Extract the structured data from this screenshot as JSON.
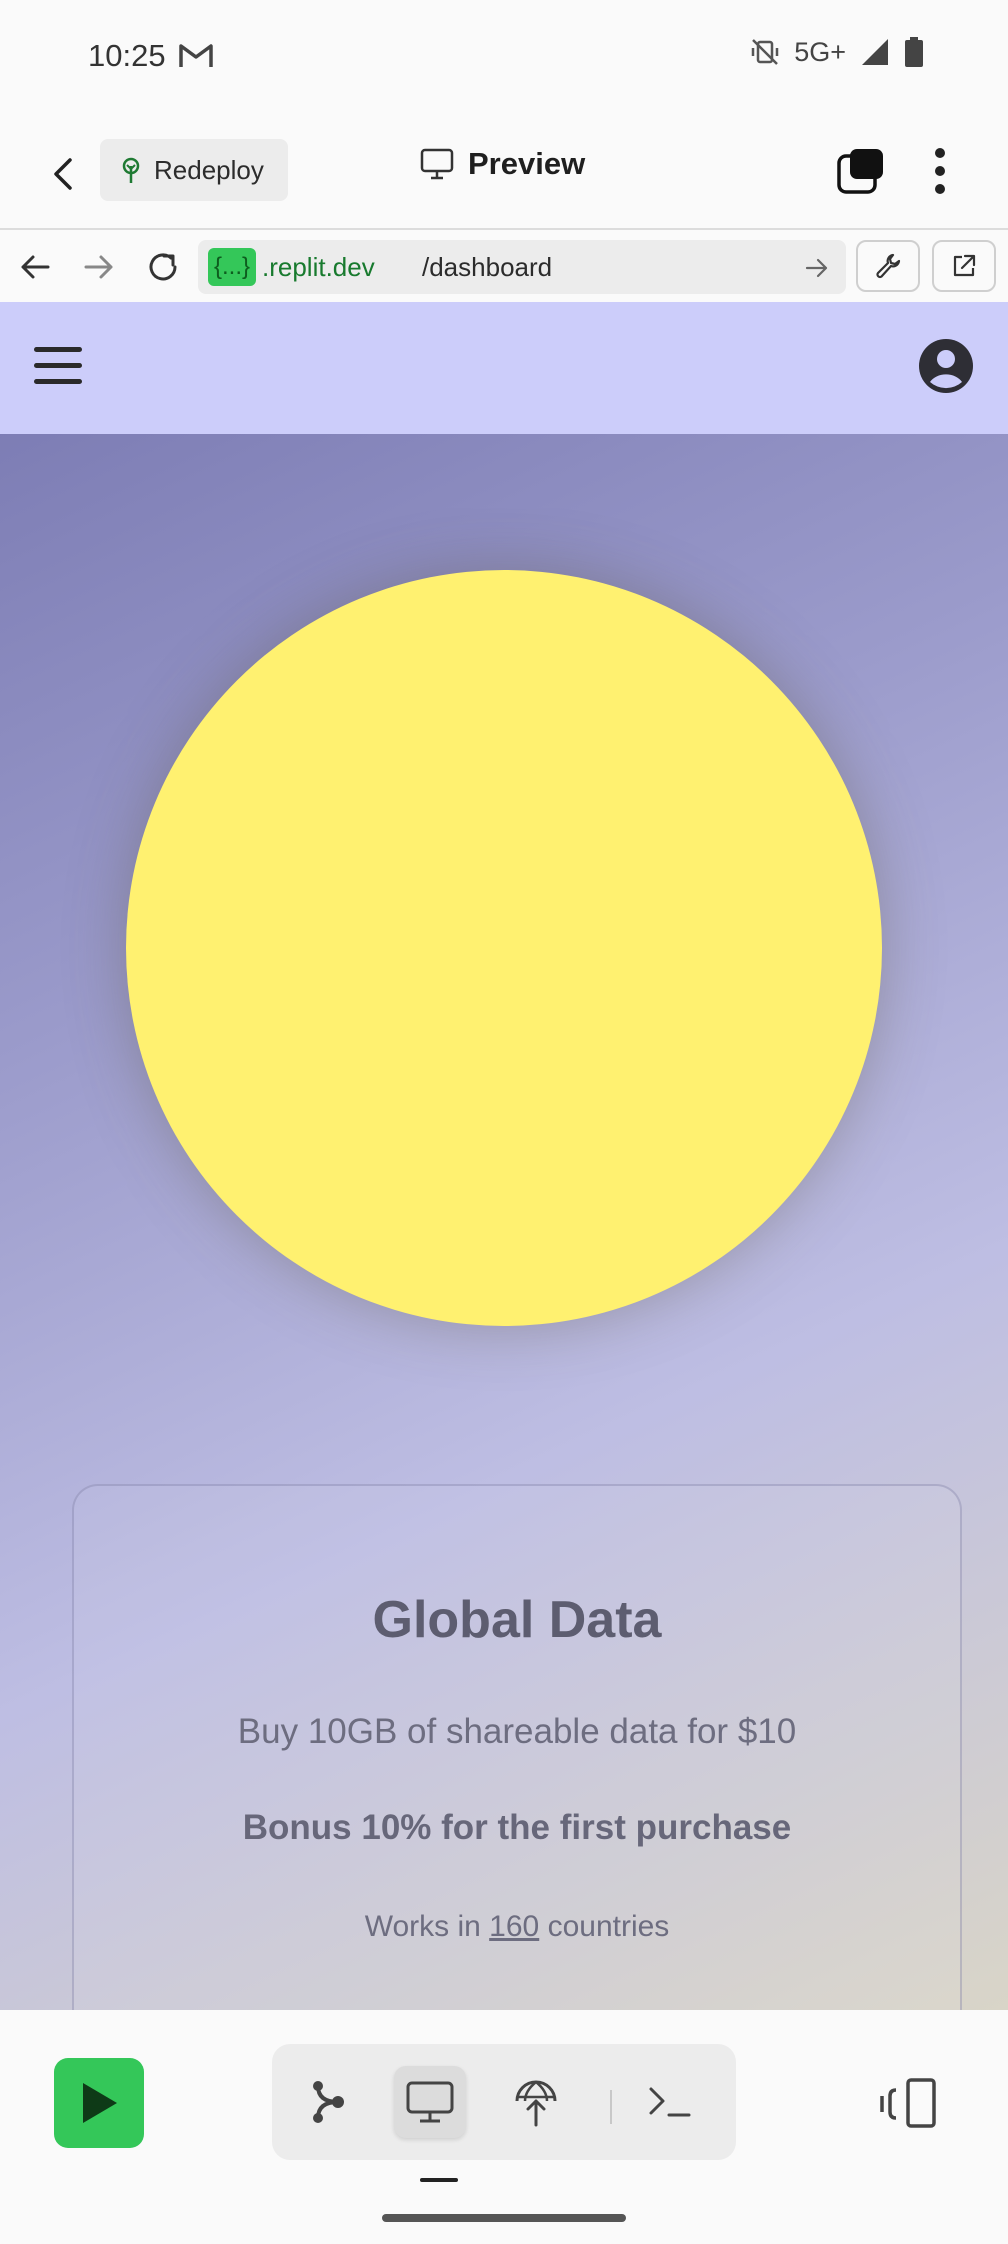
{
  "status_bar": {
    "time": "10:25",
    "network": "5G+"
  },
  "app_header": {
    "redeploy_label": "Redeploy",
    "title": "Preview"
  },
  "url_bar": {
    "domain_chip": "{...}",
    "domain": ".replit.dev",
    "path": "/dashboard"
  },
  "card": {
    "title": "Global Data",
    "subtitle": "Buy 10GB of shareable data for $10",
    "bonus": "Bonus 10% for the first purchase",
    "works_prefix": "Works in",
    "works_count": "160",
    "works_suffix": "countries"
  },
  "colors": {
    "accent_green": "#34c759",
    "site_header": "#cccdfa",
    "sun": "#fff170"
  },
  "icons": [
    "back-arrow-icon",
    "redeploy-icon",
    "monitor-icon",
    "tabs-icon",
    "more-vert-icon",
    "refresh-icon",
    "forward-icon",
    "wrench-icon",
    "external-link-icon",
    "menu-icon",
    "account-icon",
    "play-icon",
    "git-icon",
    "globe-upload-icon",
    "terminal-icon",
    "side-panel-icon"
  ]
}
